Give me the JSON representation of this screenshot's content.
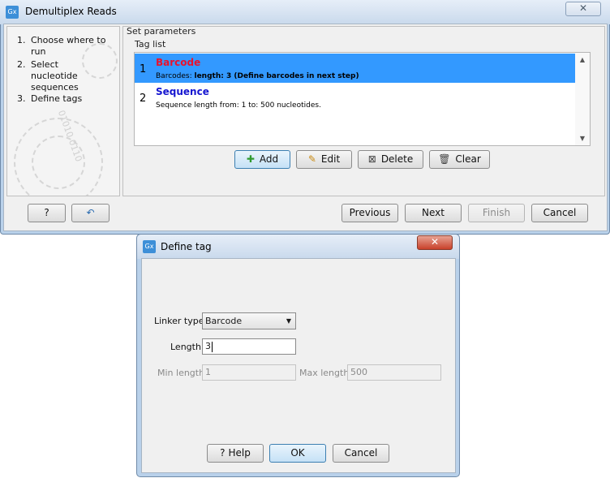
{
  "main_window": {
    "title": "Demultiplex Reads",
    "app_icon_label": "Gx",
    "close_glyph": "✕",
    "steps": [
      {
        "num": "1.",
        "label": "Choose where to run"
      },
      {
        "num": "2.",
        "label": "Select nucleotide sequences"
      },
      {
        "num": "3.",
        "label": "Define tags"
      }
    ],
    "panel_title": "Set parameters",
    "tag_list_title": "Tag list",
    "tags": [
      {
        "num": "1",
        "name": "Barcode",
        "name_color": "#e8122d",
        "desc_prefix": "Barcodes: ",
        "desc_bold": "length: 3 (Define barcodes in next step)",
        "desc_rest": ""
      },
      {
        "num": "2",
        "name": "Sequence",
        "name_color": "#1515d0",
        "desc_prefix": "Sequence length from: 1 to: 500 nucleotides.",
        "desc_bold": "",
        "desc_rest": ""
      }
    ],
    "tag_buttons": {
      "add": "Add",
      "edit": "Edit",
      "delete": "Delete",
      "clear": "Clear"
    },
    "footer_buttons": {
      "help": "?",
      "reset": "↶",
      "previous": "Previous",
      "next": "Next",
      "finish": "Finish",
      "cancel": "Cancel"
    },
    "decor_text": "01010 0110"
  },
  "dialog": {
    "title": "Define tag",
    "app_icon_label": "Gx",
    "close_glyph": "✕",
    "linker_type_label": "Linker type",
    "linker_type_value": "Barcode",
    "length_label": "Length",
    "length_value": "3",
    "min_length_label": "Min length",
    "min_length_value": "1",
    "max_length_label": "Max length",
    "max_length_value": "500",
    "buttons": {
      "help": "Help",
      "ok": "OK",
      "cancel": "Cancel"
    }
  },
  "colors": {
    "selection": "#3399ff",
    "barcode_name": "#e8122d",
    "sequence_name": "#1515d0"
  },
  "icons": [
    "app-icon",
    "close-icon",
    "add-icon",
    "edit-icon",
    "delete-icon",
    "clear-icon",
    "help-icon",
    "reset-icon",
    "dropdown-arrow-icon",
    "scroll-up-icon",
    "scroll-down-icon"
  ]
}
